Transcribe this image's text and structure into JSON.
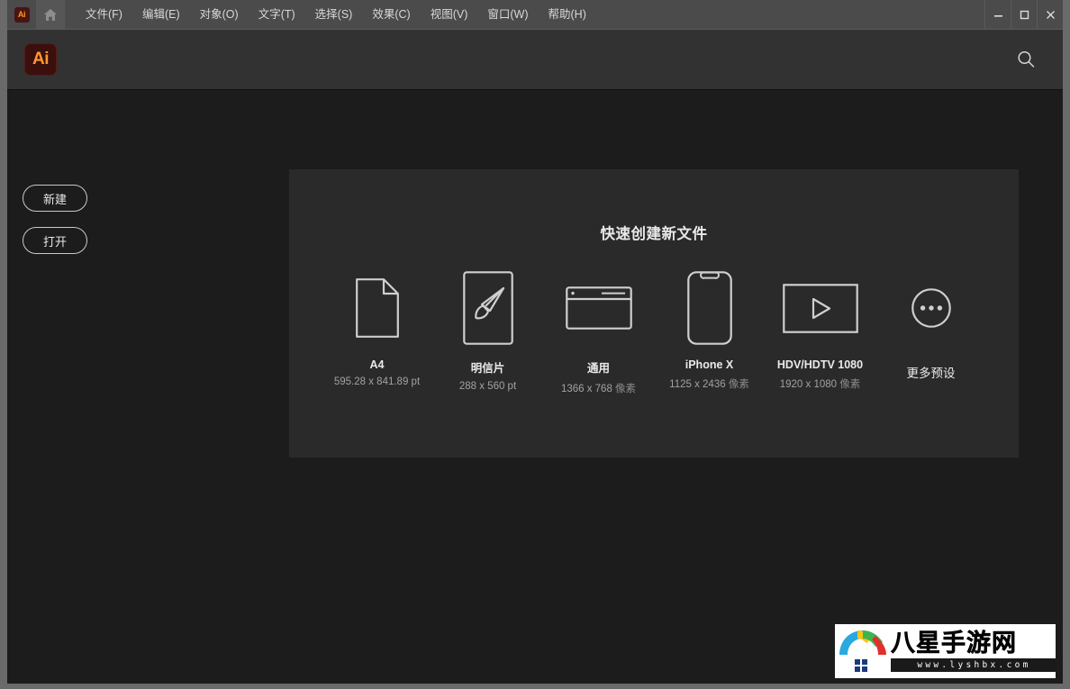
{
  "titlebar": {
    "app_badge": "Ai",
    "home_icon": "home-icon",
    "menus": [
      {
        "label": "文件(F)"
      },
      {
        "label": "编辑(E)"
      },
      {
        "label": "对象(O)"
      },
      {
        "label": "文字(T)"
      },
      {
        "label": "选择(S)"
      },
      {
        "label": "效果(C)"
      },
      {
        "label": "视图(V)"
      },
      {
        "label": "窗口(W)"
      },
      {
        "label": "帮助(H)"
      }
    ],
    "window_controls": [
      {
        "name": "minimize-button",
        "glyph": "minimize-icon"
      },
      {
        "name": "maximize-button",
        "glyph": "maximize-icon"
      },
      {
        "name": "close-button",
        "glyph": "close-icon"
      }
    ]
  },
  "header": {
    "logo_text": "Ai",
    "search_icon": "search-icon"
  },
  "sidebar": {
    "buttons": [
      {
        "label": "新建",
        "name": "new-button"
      },
      {
        "label": "打开",
        "name": "open-button"
      }
    ]
  },
  "presets": {
    "title": "快速创建新文件",
    "items": [
      {
        "name": "A4",
        "dims": "595.28 x 841.89 pt",
        "unit": "",
        "icon": "document-page-icon"
      },
      {
        "name": "明信片",
        "dims": "288 x 560 pt",
        "unit": "",
        "icon": "paintbrush-icon"
      },
      {
        "name": "通用",
        "dims": "1366 x 768 ",
        "unit": "像素",
        "icon": "browser-window-icon"
      },
      {
        "name": "iPhone X",
        "dims": "1125 x 2436 ",
        "unit": "像素",
        "icon": "phone-icon"
      },
      {
        "name": "HDV/HDTV 1080",
        "dims": "1920 x 1080 ",
        "unit": "像素",
        "icon": "video-play-icon"
      },
      {
        "name": "更多预设",
        "dims": "",
        "unit": "",
        "icon": "ellipsis-circle-icon"
      }
    ]
  },
  "watermark": {
    "title": "八星手游网",
    "url": "www.lyshbx.com",
    "logo_icon": "rainbow-house-icon"
  },
  "colors": {
    "titlebar_bg": "#4b4b4b",
    "header_bg": "#323232",
    "page_bg": "#1c1c1c",
    "panel_bg": "#2a2a2a",
    "accent_orange": "#ff9a2e",
    "logo_maroon": "#3b0f0d",
    "text_primary": "#eaeaea",
    "text_secondary": "#a2a2a2"
  }
}
